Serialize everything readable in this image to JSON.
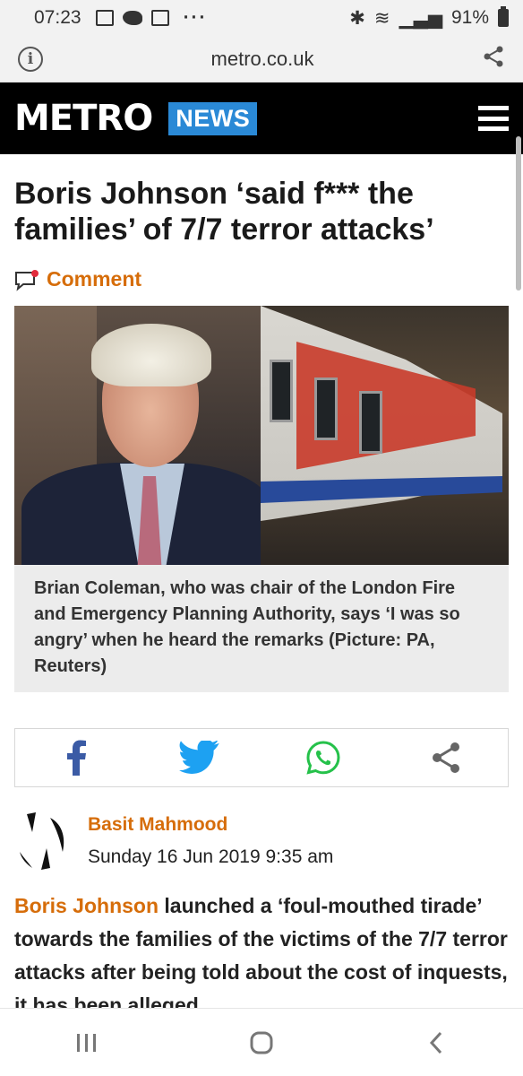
{
  "status_bar": {
    "time": "07:23",
    "battery": "91%",
    "notification_icons": [
      "gallery-icon",
      "twitter-icon",
      "email-icon",
      "more-dots-icon"
    ],
    "more": "···"
  },
  "browser": {
    "url": "metro.co.uk"
  },
  "site_header": {
    "logo": "METRO",
    "section": "NEWS",
    "section_color": "#2a89d6"
  },
  "article": {
    "headline": "Boris Johnson ‘said f*** the families’ of 7/7 terror attacks’",
    "comment_label": "Comment",
    "accent_color": "#d66d0a",
    "caption": "Brian Coleman, who was chair of the London Fire and Emergency Planning Authority, says ‘I was so angry’ when he heard the remarks (Picture: PA, Reuters)",
    "share_buttons": [
      "facebook-icon",
      "twitter-icon",
      "whatsapp-icon",
      "share-icon"
    ],
    "author": "Basit Mahmood",
    "date": "Sunday 16 Jun 2019 9:35 am",
    "lead_link": "Boris Johnson",
    "lead_text": " launched a ‘foul-mouthed tirade’ towards the families of the victims of the 7/7 terror attacks after being told about the cost of inquests, it has been alleged."
  }
}
